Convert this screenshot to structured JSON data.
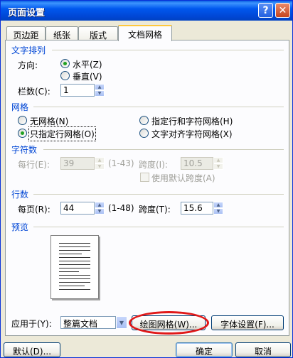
{
  "window": {
    "title": "页面设置",
    "help_label": "?",
    "close_label": "✕"
  },
  "tabs": [
    {
      "label": "页边距",
      "active": false
    },
    {
      "label": "纸张",
      "active": false
    },
    {
      "label": "版式",
      "active": false
    },
    {
      "label": "文档网格",
      "active": true
    }
  ],
  "text_layout": {
    "section_title": "文字排列",
    "direction_label": "方向:",
    "horizontal_label": "水平(Z)",
    "vertical_label": "垂直(V)",
    "direction_value": "horizontal",
    "columns_label": "栏数(C):",
    "columns_value": "1"
  },
  "grid": {
    "section_title": "网格",
    "options": {
      "no_grid": "无网格(N)",
      "line_and_char": "指定行和字符网格(H)",
      "line_only": "只指定行网格(O)",
      "snap_to_char": "文字对齐字符网格(X)"
    },
    "selected": "line_only"
  },
  "chars": {
    "section_title": "字符数",
    "per_line_label": "每行(E):",
    "per_line_value": "39",
    "per_line_range": "(1-43)",
    "pitch_label": "跨度(I):",
    "pitch_value": "10.5 磅",
    "default_pitch_label": "使用默认跨度(A)"
  },
  "lines": {
    "section_title": "行数",
    "per_page_label": "每页(R):",
    "per_page_value": "44",
    "per_page_range": "(1-48)",
    "pitch_label": "跨度(T):",
    "pitch_value": "15.6 磅"
  },
  "preview": {
    "section_title": "预览"
  },
  "footer": {
    "apply_to_label": "应用于(Y):",
    "apply_to_value": "整篇文档",
    "draw_grid_label": "绘图网格(W)...",
    "font_settings_label": "字体设置(F)...",
    "default_label": "默认(D)...",
    "ok_label": "确定",
    "cancel_label": "取消"
  }
}
